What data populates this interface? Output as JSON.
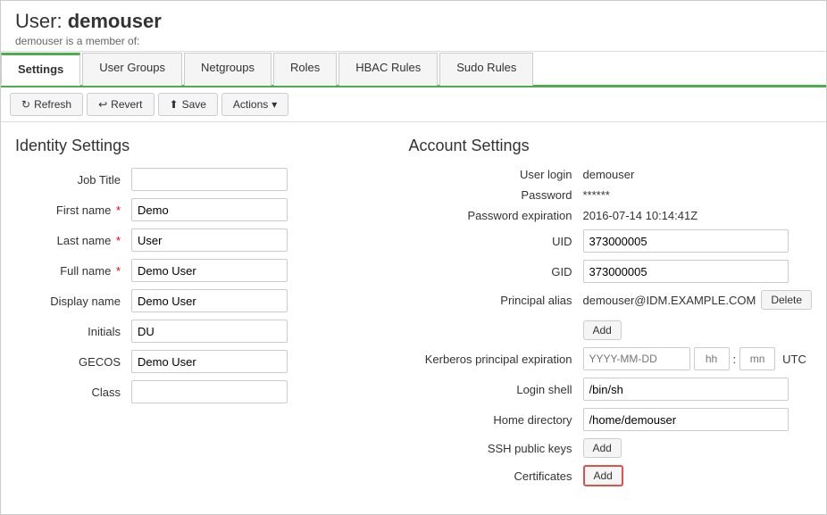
{
  "header": {
    "title_prefix": "User:",
    "username": "demouser",
    "subtitle": "demouser is a member of:"
  },
  "tabs": [
    {
      "id": "settings",
      "label": "Settings",
      "active": true
    },
    {
      "id": "user-groups",
      "label": "User Groups",
      "active": false
    },
    {
      "id": "netgroups",
      "label": "Netgroups",
      "active": false
    },
    {
      "id": "roles",
      "label": "Roles",
      "active": false
    },
    {
      "id": "hbac-rules",
      "label": "HBAC Rules",
      "active": false
    },
    {
      "id": "sudo-rules",
      "label": "Sudo Rules",
      "active": false
    }
  ],
  "toolbar": {
    "refresh_label": "Refresh",
    "revert_label": "Revert",
    "save_label": "Save",
    "actions_label": "Actions"
  },
  "identity": {
    "section_title": "Identity Settings",
    "fields": [
      {
        "id": "job-title",
        "label": "Job Title",
        "value": "",
        "placeholder": "",
        "required": false
      },
      {
        "id": "first-name",
        "label": "First name",
        "value": "Demo",
        "placeholder": "",
        "required": true
      },
      {
        "id": "last-name",
        "label": "Last name",
        "value": "User",
        "placeholder": "",
        "required": true
      },
      {
        "id": "full-name",
        "label": "Full name",
        "value": "Demo User",
        "placeholder": "",
        "required": true
      },
      {
        "id": "display-name",
        "label": "Display name",
        "value": "Demo User",
        "placeholder": "",
        "required": false
      },
      {
        "id": "initials",
        "label": "Initials",
        "value": "DU",
        "placeholder": "",
        "required": false
      },
      {
        "id": "gecos",
        "label": "GECOS",
        "value": "Demo User",
        "placeholder": "",
        "required": false
      },
      {
        "id": "class",
        "label": "Class",
        "value": "",
        "placeholder": "",
        "required": false
      }
    ]
  },
  "account": {
    "section_title": "Account Settings",
    "user_login_label": "User login",
    "user_login_value": "demouser",
    "password_label": "Password",
    "password_value": "******",
    "password_expiration_label": "Password expiration",
    "password_expiration_value": "2016-07-14 10:14:41Z",
    "uid_label": "UID",
    "uid_value": "373000005",
    "gid_label": "GID",
    "gid_value": "373000005",
    "principal_alias_label": "Principal alias",
    "principal_alias_value": "demouser@IDM.EXAMPLE.COM",
    "delete_label": "Delete",
    "add_label": "Add",
    "kerberos_label": "Kerberos principal expiration",
    "kerberos_date_placeholder": "YYYY-MM-DD",
    "kerberos_hh_placeholder": "hh",
    "kerberos_mn_placeholder": "mn",
    "utc_label": "UTC",
    "login_shell_label": "Login shell",
    "login_shell_value": "/bin/sh",
    "home_directory_label": "Home directory",
    "home_directory_value": "/home/demouser",
    "ssh_public_keys_label": "SSH public keys",
    "ssh_add_label": "Add",
    "certificates_label": "Certificates",
    "certificates_add_label": "Add"
  }
}
